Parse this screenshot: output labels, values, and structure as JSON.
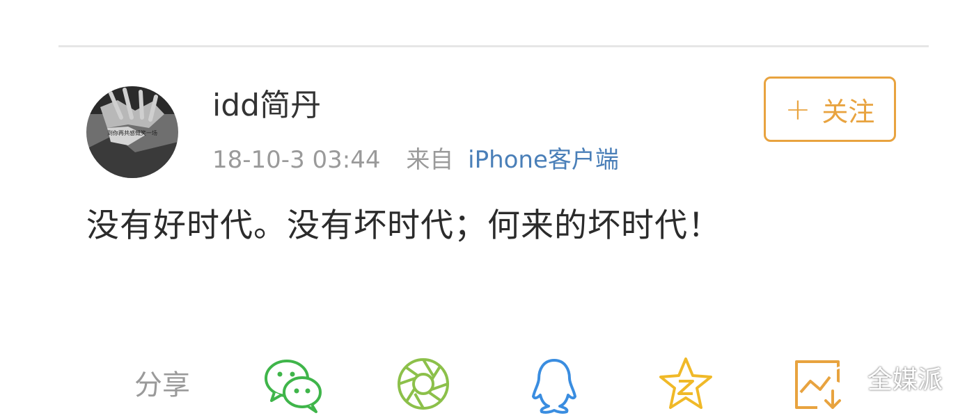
{
  "post": {
    "username": "idd简丹",
    "timestamp": "18-10-3 03:44",
    "source_prefix": "来自",
    "source_app": "iPhone客户端",
    "follow_label": "关注",
    "follow_plus": "+",
    "text": "没有好时代。没有坏时代；何来的坏时代！",
    "avatar_caption": "到你再共感慨笑一场"
  },
  "share": {
    "label": "分享",
    "icons": [
      "wechat-icon",
      "moments-icon",
      "qq-icon",
      "qzone-icon",
      "save-image-icon"
    ]
  },
  "watermark": {
    "text": "全媒派"
  },
  "colors": {
    "accent": "#e8a33f",
    "link": "#4a7fb8",
    "wechat": "#3fb54a",
    "moments": "#8cc04a",
    "qq": "#3a8de0",
    "qzone": "#f0b928"
  }
}
